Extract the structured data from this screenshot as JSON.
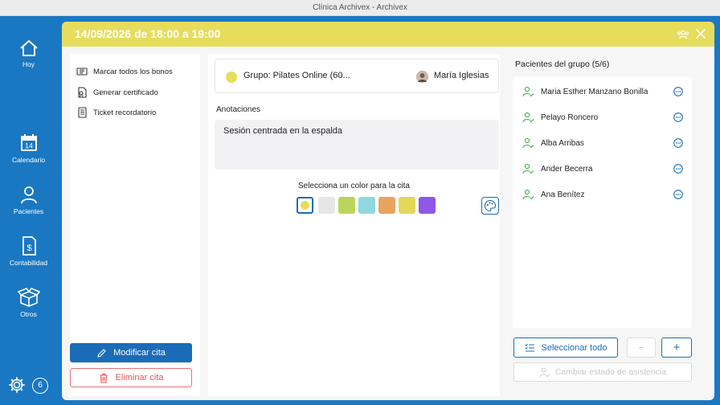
{
  "window": {
    "title": "Clínica Archivex - Archivex"
  },
  "sidebar": {
    "items": [
      {
        "label": "Hoy",
        "icon": "home-icon"
      },
      {
        "label": "Calendario",
        "icon": "calendar-icon",
        "day": "14"
      },
      {
        "label": "Pacientes",
        "icon": "user-icon"
      },
      {
        "label": "Contabilidad",
        "icon": "invoice-icon"
      },
      {
        "label": "Otros",
        "icon": "box-icon"
      }
    ],
    "badge_count": "6"
  },
  "modal": {
    "title": "14/09/2026 de 18:00 a 19:00",
    "header_color": "#e6dd5c"
  },
  "actions": {
    "items": [
      {
        "label": "Marcar todos los bonos",
        "icon": "ticket-icon"
      },
      {
        "label": "Generar certificado",
        "icon": "certificate-icon"
      },
      {
        "label": "Ticket recordatorio",
        "icon": "receipt-icon"
      }
    ],
    "modify_label": "Modificar cita",
    "delete_label": "Eliminar cita"
  },
  "appointment": {
    "group_name": "Grupo: Pilates Online (60...",
    "therapist": "María Iglesias",
    "annotations_label": "Anotaciones",
    "annotations_text": "Sesión centrada en la espalda",
    "color_label": "Selecciona un color para la cita",
    "colors": [
      "#e6dd5c",
      "#e6e6e6",
      "#b9d65a",
      "#8ed8de",
      "#e8a45e",
      "#e2d85a",
      "#8e57e6"
    ],
    "selected_color_index": 0
  },
  "patients": {
    "title": "Pacientes del grupo (5/6)",
    "list": [
      "Maria Esther Manzano Bonilla",
      "Pelayo Roncero",
      "Alba Arribas",
      "Ander Becerra",
      "Ana Benítez"
    ],
    "select_all_label": "Seleccionar todo",
    "minus_label": "−",
    "plus_label": "+",
    "attendance_label": "Cambiar estado de asistencia"
  }
}
